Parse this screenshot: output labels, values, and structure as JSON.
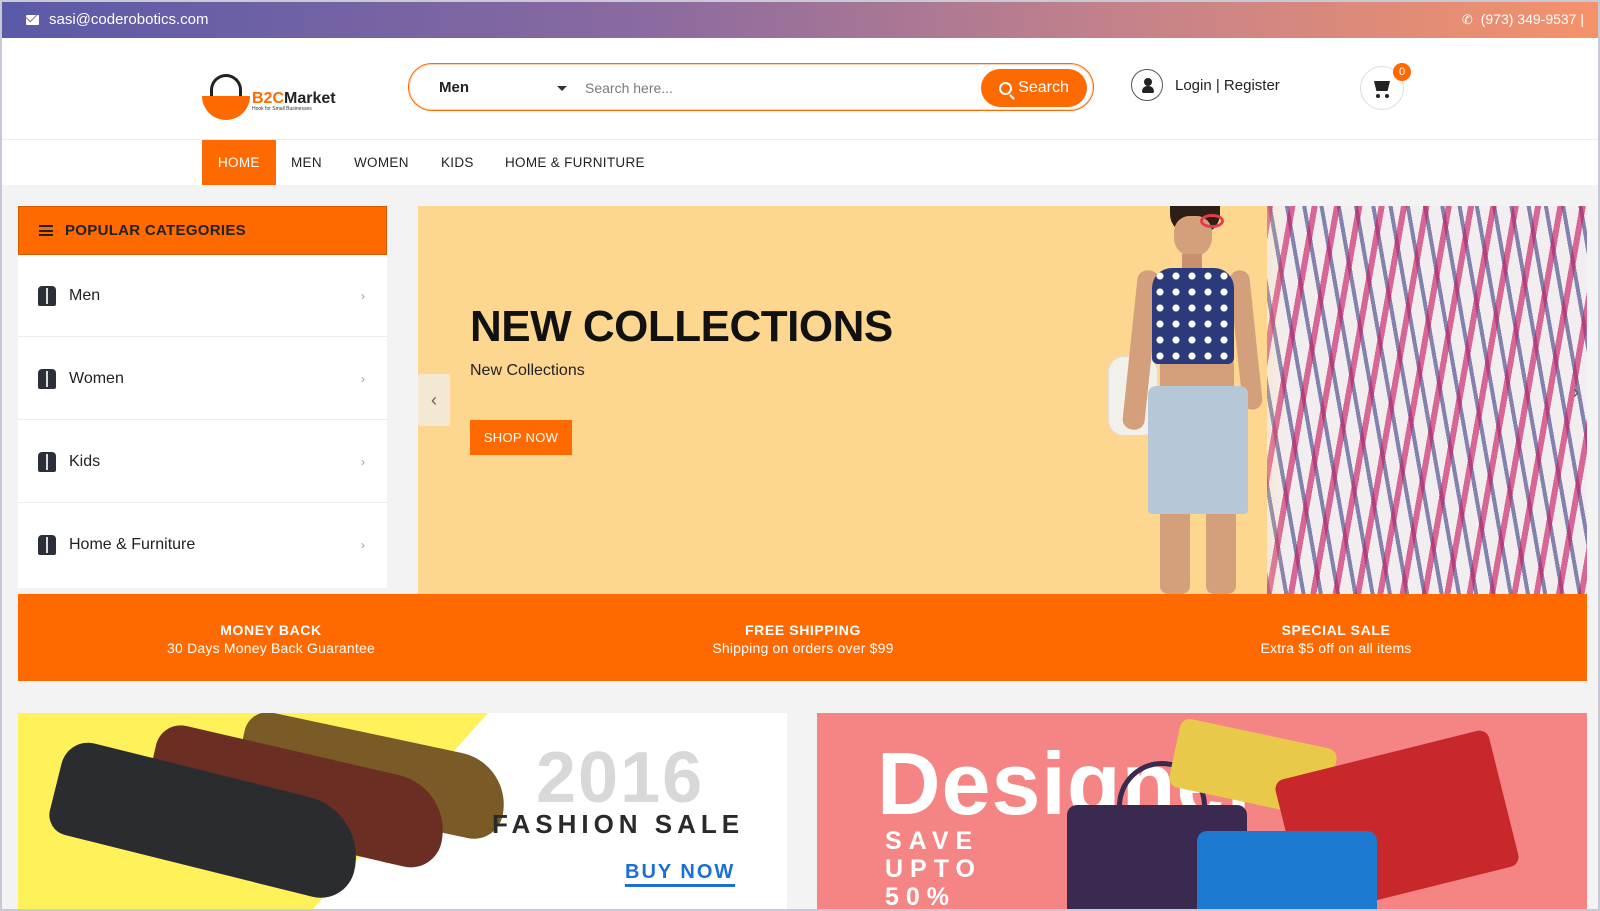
{
  "topbar": {
    "email": "sasi@coderobotics.com",
    "phone": "(973) 349-9537 |"
  },
  "header": {
    "logo": {
      "name_b2c": "B2C",
      "name_market": "Market",
      "tagline": "Hook for Small Businesses"
    },
    "search": {
      "category": "Men",
      "placeholder": "Search here...",
      "button_label": "Search"
    },
    "account": {
      "login_register": "Login | Register"
    },
    "cart": {
      "count": "0"
    }
  },
  "nav": {
    "items": [
      {
        "label": "HOME",
        "active": true
      },
      {
        "label": "MEN"
      },
      {
        "label": "WOMEN"
      },
      {
        "label": "KIDS"
      },
      {
        "label": "HOME & FURNITURE"
      }
    ]
  },
  "sidebar": {
    "title": "POPULAR CATEGORIES",
    "items": [
      {
        "label": "Men"
      },
      {
        "label": "Women"
      },
      {
        "label": "Kids"
      },
      {
        "label": "Home & Furniture"
      }
    ]
  },
  "banner": {
    "title": "NEW COLLECTIONS",
    "subtitle": "New Collections",
    "button_label": "SHOP NOW"
  },
  "features": [
    {
      "title": "MONEY BACK",
      "desc": "30 Days Money Back Guarantee"
    },
    {
      "title": "FREE SHIPPING",
      "desc": "Shipping on orders over $99"
    },
    {
      "title": "SPECIAL SALE",
      "desc": "Extra $5 off on all items"
    }
  ],
  "promo_left": {
    "year": "2016",
    "sale": "FASHION SALE",
    "cta": "BUY NOW"
  },
  "promo_right": {
    "headline": "Designer",
    "save_line1": "SAVE",
    "save_line2": "UPTO",
    "save_line3": "50%"
  },
  "colors": {
    "accent": "#ff6a00",
    "topbar_start": "#5a5aa8",
    "topbar_end": "#f5926a",
    "link_blue": "#1a6fd8"
  }
}
